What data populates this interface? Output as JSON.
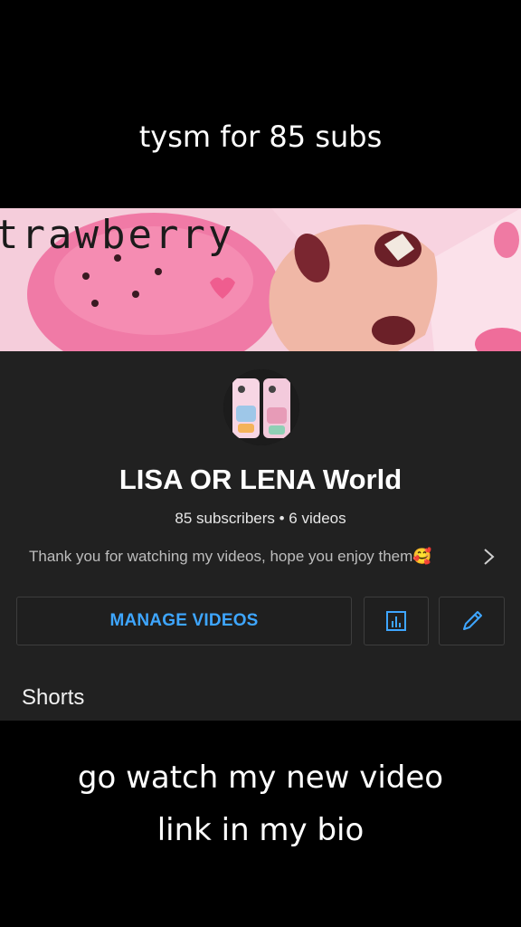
{
  "overlay": {
    "top_caption": "tysm for 85 subs",
    "bottom_caption_lines": [
      "go watch my new video",
      "link in my bio"
    ]
  },
  "banner": {
    "text": "trawberry",
    "colors": {
      "background": "#f3c6d6",
      "strawberry": "#f27aa6",
      "nail": "#6b2028"
    }
  },
  "channel": {
    "name": "LISA OR LENA World",
    "stats": "85 subscribers • 6 videos",
    "description": "Thank you for watching my videos, hope you enjoy them🥰"
  },
  "actions": {
    "manage_videos_label": "MANAGE VIDEOS",
    "analytics_icon": "analytics-icon",
    "edit_icon": "pencil-icon"
  },
  "sections": {
    "shorts_label": "Shorts"
  },
  "theme": {
    "panel_bg": "#212121",
    "accent": "#3ea6ff"
  }
}
